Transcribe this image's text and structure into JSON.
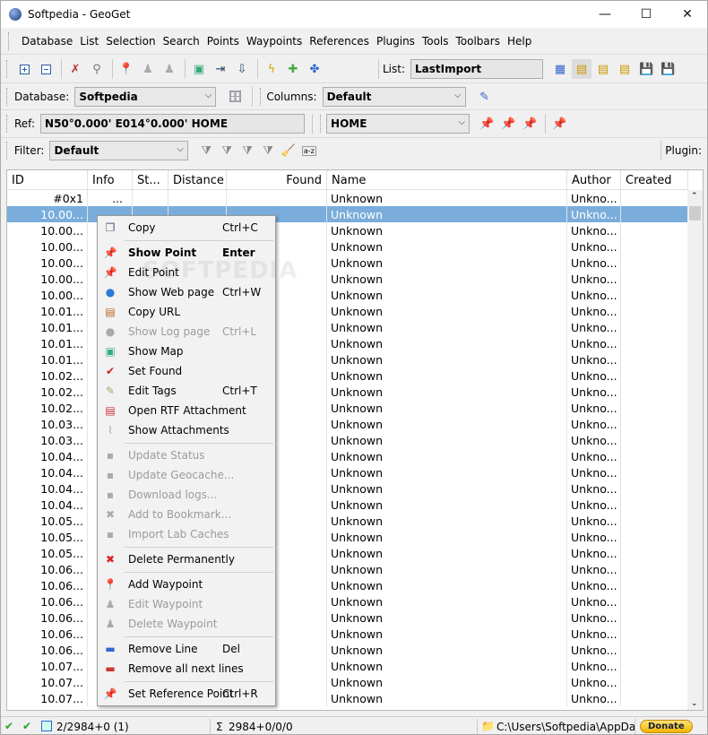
{
  "window": {
    "title": "Softpedia - GeoGet",
    "min": "—",
    "max": "☐",
    "close": "✕"
  },
  "menu": [
    "Database",
    "List",
    "Selection",
    "Search",
    "Points",
    "Waypoints",
    "References",
    "Plugins",
    "Tools",
    "Toolbars",
    "Help"
  ],
  "toolbar": {
    "list_label": "List:",
    "list_value": "LastImport",
    "database_label": "Database:",
    "database_value": "Softpedia",
    "columns_label": "Columns:",
    "columns_value": "Default",
    "ref_label": "Ref:",
    "ref_coords": "N50°0.000' E014°0.000' HOME",
    "ref_value": "HOME",
    "filter_label": "Filter:",
    "filter_value": "Default",
    "plugin_label": "Plugin:",
    "az": "a-z"
  },
  "grid": {
    "columns": [
      "ID",
      "Info",
      "St...",
      "Distance",
      "Found",
      "Name",
      "Author",
      "Created"
    ],
    "rows": [
      {
        "id": "#0x1",
        "info": "...",
        "name": "Unknown",
        "author": "Unkno..."
      },
      {
        "id": "10.00...",
        "info": "",
        "name": "Unknown",
        "author": "Unkno...",
        "selected": true
      },
      {
        "id": "10.00...",
        "name": "Unknown",
        "author": "Unkno..."
      },
      {
        "id": "10.00...",
        "name": "Unknown",
        "author": "Unkno..."
      },
      {
        "id": "10.00...",
        "name": "Unknown",
        "author": "Unkno..."
      },
      {
        "id": "10.00...",
        "name": "Unknown",
        "author": "Unkno..."
      },
      {
        "id": "10.00...",
        "name": "Unknown",
        "author": "Unkno..."
      },
      {
        "id": "10.01...",
        "name": "Unknown",
        "author": "Unkno..."
      },
      {
        "id": "10.01...",
        "name": "Unknown",
        "author": "Unkno..."
      },
      {
        "id": "10.01...",
        "name": "Unknown",
        "author": "Unkno..."
      },
      {
        "id": "10.01...",
        "name": "Unknown",
        "author": "Unkno..."
      },
      {
        "id": "10.02...",
        "name": "Unknown",
        "author": "Unkno..."
      },
      {
        "id": "10.02...",
        "name": "Unknown",
        "author": "Unkno..."
      },
      {
        "id": "10.02...",
        "name": "Unknown",
        "author": "Unkno..."
      },
      {
        "id": "10.03...",
        "name": "Unknown",
        "author": "Unkno..."
      },
      {
        "id": "10.03...",
        "name": "Unknown",
        "author": "Unkno..."
      },
      {
        "id": "10.04...",
        "name": "Unknown",
        "author": "Unkno..."
      },
      {
        "id": "10.04...",
        "name": "Unknown",
        "author": "Unkno..."
      },
      {
        "id": "10.04...",
        "name": "Unknown",
        "author": "Unkno..."
      },
      {
        "id": "10.04...",
        "name": "Unknown",
        "author": "Unkno..."
      },
      {
        "id": "10.05...",
        "name": "Unknown",
        "author": "Unkno..."
      },
      {
        "id": "10.05...",
        "name": "Unknown",
        "author": "Unkno..."
      },
      {
        "id": "10.05...",
        "name": "Unknown",
        "author": "Unkno..."
      },
      {
        "id": "10.06...",
        "name": "Unknown",
        "author": "Unkno..."
      },
      {
        "id": "10.06...",
        "name": "Unknown",
        "author": "Unkno..."
      },
      {
        "id": "10.06...",
        "name": "Unknown",
        "author": "Unkno..."
      },
      {
        "id": "10.06...",
        "name": "Unknown",
        "author": "Unkno..."
      },
      {
        "id": "10.06...",
        "name": "Unknown",
        "author": "Unkno..."
      },
      {
        "id": "10.06...",
        "name": "Unknown",
        "author": "Unkno..."
      },
      {
        "id": "10.07...",
        "name": "Unknown",
        "author": "Unkno..."
      },
      {
        "id": "10.07...",
        "name": "Unknown",
        "author": "Unkno..."
      },
      {
        "id": "10.07...",
        "name": "Unknown",
        "author": "Unkno..."
      }
    ]
  },
  "context_menu": [
    {
      "label": "Copy",
      "shortcut": "Ctrl+C",
      "icon": "copy-icon"
    },
    {
      "sep": true
    },
    {
      "label": "Show Point",
      "shortcut": "Enter",
      "bold": true,
      "icon": "pin-icon"
    },
    {
      "label": "Edit Point",
      "icon": "pin-edit-icon"
    },
    {
      "label": "Show Web page",
      "shortcut": "Ctrl+W",
      "icon": "globe-icon"
    },
    {
      "label": "Copy URL",
      "icon": "copy-url-icon"
    },
    {
      "label": "Show Log page",
      "shortcut": "Ctrl+L",
      "disabled": true,
      "icon": "log-icon"
    },
    {
      "label": "Show Map",
      "icon": "map-icon"
    },
    {
      "label": "Set Found",
      "icon": "checkmark-icon"
    },
    {
      "label": "Edit Tags",
      "shortcut": "Ctrl+T",
      "icon": "tag-icon"
    },
    {
      "label": "Open RTF Attachment",
      "icon": "rtf-icon"
    },
    {
      "label": "Show Attachments",
      "icon": "paperclip-icon"
    },
    {
      "sep": true
    },
    {
      "label": "Update Status",
      "disabled": true,
      "icon": "update-icon"
    },
    {
      "label": "Update Geocache...",
      "disabled": true,
      "icon": "update-geocache-icon"
    },
    {
      "label": "Download logs...",
      "disabled": true,
      "icon": "download-icon"
    },
    {
      "label": "Add to Bookmark...",
      "disabled": true,
      "icon": "bookmark-icon"
    },
    {
      "label": "Import Lab Caches",
      "disabled": true,
      "icon": "import-icon"
    },
    {
      "sep": true
    },
    {
      "label": "Delete Permanently",
      "icon": "delete-icon"
    },
    {
      "sep": true
    },
    {
      "label": "Add Waypoint",
      "icon": "waypoint-add-icon"
    },
    {
      "label": "Edit Waypoint",
      "disabled": true,
      "icon": "waypoint-edit-icon"
    },
    {
      "label": "Delete Waypoint",
      "disabled": true,
      "icon": "waypoint-delete-icon"
    },
    {
      "sep": true
    },
    {
      "label": "Remove Line",
      "shortcut": "Del",
      "icon": "remove-line-icon"
    },
    {
      "label": "Remove all next lines",
      "icon": "remove-lines-icon"
    },
    {
      "sep": true
    },
    {
      "label": "Set Reference Point",
      "shortcut": "Ctrl+R",
      "icon": "reference-pin-icon"
    }
  ],
  "status": {
    "count": "2/2984+0 (1)",
    "sigma": "Σ",
    "totals": "2984+0/0/0",
    "path": "C:\\Users\\Softpedia\\AppData\\",
    "donate": "Donate"
  },
  "colors": {
    "selection": "#7aaddb",
    "accent": "#0078d7"
  }
}
